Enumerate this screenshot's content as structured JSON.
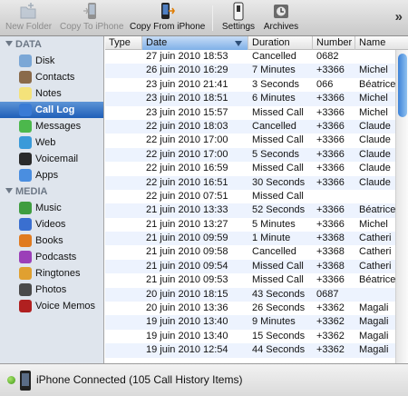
{
  "toolbar": {
    "new_folder": "New Folder",
    "copy_to_iphone": "Copy To iPhone",
    "copy_from_iphone": "Copy From iPhone",
    "settings": "Settings",
    "archives": "Archives",
    "more": "»"
  },
  "sidebar": {
    "data_header": "DATA",
    "media_header": "MEDIA",
    "data_items": [
      {
        "label": "Disk",
        "icon": "disk-icon",
        "color": "#7ba7d6"
      },
      {
        "label": "Contacts",
        "icon": "contacts-icon",
        "color": "#8a6a4a"
      },
      {
        "label": "Notes",
        "icon": "notes-icon",
        "color": "#f4e27a"
      },
      {
        "label": "Call Log",
        "icon": "call-log-icon",
        "color": "#3a7bd5",
        "selected": true
      },
      {
        "label": "Messages",
        "icon": "messages-icon",
        "color": "#4cb84c"
      },
      {
        "label": "Web",
        "icon": "web-icon",
        "color": "#3a9ad9"
      },
      {
        "label": "Voicemail",
        "icon": "voicemail-icon",
        "color": "#2a2a2a"
      },
      {
        "label": "Apps",
        "icon": "apps-icon",
        "color": "#4a8ee0"
      }
    ],
    "media_items": [
      {
        "label": "Music",
        "icon": "music-icon",
        "color": "#3f9d3f"
      },
      {
        "label": "Videos",
        "icon": "videos-icon",
        "color": "#3a6fd0"
      },
      {
        "label": "Books",
        "icon": "books-icon",
        "color": "#e07b20"
      },
      {
        "label": "Podcasts",
        "icon": "podcasts-icon",
        "color": "#9b3fb8"
      },
      {
        "label": "Ringtones",
        "icon": "ringtones-icon",
        "color": "#e0a030"
      },
      {
        "label": "Photos",
        "icon": "photos-icon",
        "color": "#4a4a4a"
      },
      {
        "label": "Voice Memos",
        "icon": "voice-memos-icon",
        "color": "#b02020"
      }
    ]
  },
  "table": {
    "columns": [
      "Type",
      "Date",
      "Duration",
      "Number",
      "Name"
    ],
    "rows": [
      {
        "type": "cancelled",
        "date": "27 juin 2010 18:53",
        "duration": "Cancelled",
        "number": "0682",
        "name": ""
      },
      {
        "type": "received",
        "date": "26 juin 2010 16:29",
        "duration": "7 Minutes",
        "number": "+3366",
        "name": "Michel"
      },
      {
        "type": "received",
        "date": "23 juin 2010 21:41",
        "duration": "3 Seconds",
        "number": "066",
        "name": "Béatrice"
      },
      {
        "type": "missed",
        "date": "23 juin 2010 18:51",
        "duration": "6 Minutes",
        "number": "+3366",
        "name": "Michel"
      },
      {
        "type": "missed",
        "date": "23 juin 2010 15:57",
        "duration": "Missed Call",
        "number": "+3366",
        "name": "Michel"
      },
      {
        "type": "cancelled",
        "date": "22 juin 2010 18:03",
        "duration": "Cancelled",
        "number": "+3366",
        "name": "Claude"
      },
      {
        "type": "missed",
        "date": "22 juin 2010 17:00",
        "duration": "Missed Call",
        "number": "+3366",
        "name": "Claude"
      },
      {
        "type": "received",
        "date": "22 juin 2010 17:00",
        "duration": "5 Seconds",
        "number": "+3366",
        "name": "Claude"
      },
      {
        "type": "missed",
        "date": "22 juin 2010 16:59",
        "duration": "Missed Call",
        "number": "+3366",
        "name": "Claude"
      },
      {
        "type": "received",
        "date": "22 juin 2010 16:51",
        "duration": "30 Seconds",
        "number": "+3366",
        "name": "Claude"
      },
      {
        "type": "missed",
        "date": "22 juin 2010 07:51",
        "duration": "Missed Call",
        "number": "",
        "name": ""
      },
      {
        "type": "received",
        "date": "21 juin 2010 13:33",
        "duration": "52 Seconds",
        "number": "+3366",
        "name": "Béatrice"
      },
      {
        "type": "received",
        "date": "21 juin 2010 13:27",
        "duration": "5 Minutes",
        "number": "+3366",
        "name": "Michel"
      },
      {
        "type": "received",
        "date": "21 juin 2010 09:59",
        "duration": "1 Minute",
        "number": "+3368",
        "name": "Catheri"
      },
      {
        "type": "cancelled",
        "date": "21 juin 2010 09:58",
        "duration": "Cancelled",
        "number": "+3368",
        "name": "Catheri"
      },
      {
        "type": "missed",
        "date": "21 juin 2010 09:54",
        "duration": "Missed Call",
        "number": "+3368",
        "name": "Catheri"
      },
      {
        "type": "missed",
        "date": "21 juin 2010 09:53",
        "duration": "Missed Call",
        "number": "+3366",
        "name": "Béatrice"
      },
      {
        "type": "received",
        "date": "20 juin 2010 18:15",
        "duration": "43 Seconds",
        "number": "0687",
        "name": ""
      },
      {
        "type": "received",
        "date": "20 juin 2010 13:36",
        "duration": "26 Seconds",
        "number": "+3362",
        "name": "Magali"
      },
      {
        "type": "received",
        "date": "19 juin 2010 13:40",
        "duration": "9 Minutes",
        "number": "+3362",
        "name": "Magali"
      },
      {
        "type": "received",
        "date": "19 juin 2010 13:40",
        "duration": "15 Seconds",
        "number": "+3362",
        "name": "Magali"
      },
      {
        "type": "received",
        "date": "19 juin 2010 12:54",
        "duration": "44 Seconds",
        "number": "+3362",
        "name": "Magali"
      }
    ]
  },
  "status": {
    "text": "iPhone Connected (105 Call History Items)"
  },
  "colors": {
    "received": "#21a02a",
    "missed": "#cc1a1a",
    "cancelled": "#b9b9b9",
    "selection": "#1f5fb8"
  }
}
